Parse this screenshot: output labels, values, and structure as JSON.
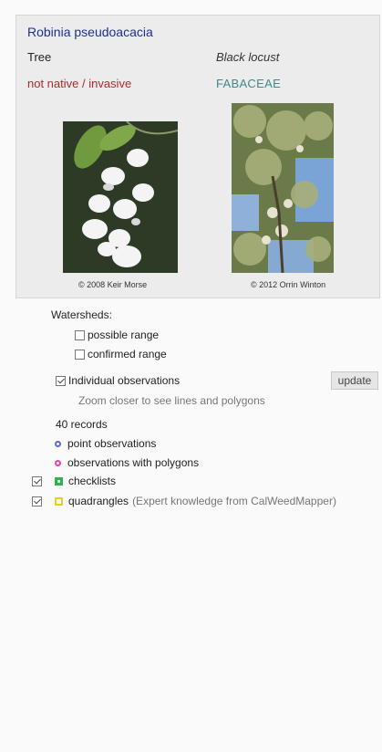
{
  "species": {
    "scientific_name": "Robinia pseudoacacia",
    "habit": "Tree",
    "common_name": "Black locust",
    "status": "not native / invasive",
    "family": "FABACEAE",
    "photos": [
      {
        "credit": "© 2008 Keir Morse",
        "subject": "white-flower-cluster"
      },
      {
        "credit": "© 2012 Orrin Winton",
        "subject": "tree-canopy"
      }
    ]
  },
  "layers": {
    "watersheds": {
      "label": "Watersheds:",
      "possible_range": {
        "label": "possible range",
        "checked": false
      },
      "confirmed_range": {
        "label": "confirmed range",
        "checked": false
      }
    },
    "observations": {
      "label": "Individual observations",
      "checked": true
    },
    "update_label": "update",
    "zoom_hint": "Zoom closer to see lines and polygons",
    "records": "40 records",
    "legend": {
      "point": "point observations",
      "polygons": "observations with polygons"
    },
    "checklists": {
      "label": "checklists",
      "checked": true
    },
    "quadrangles": {
      "label": "quadrangles",
      "note": "(Expert knowledge from CalWeedMapper)",
      "checked": true
    }
  },
  "colors": {
    "scientific_name": "#1a2f9a",
    "status": "#b02a2a",
    "family": "#3d8a8a",
    "point_marker": "#5b6ad6",
    "polygon_marker": "#e046a6",
    "checklist_marker": "#2bb54b",
    "quadrangle_marker": "#e6d21e"
  }
}
